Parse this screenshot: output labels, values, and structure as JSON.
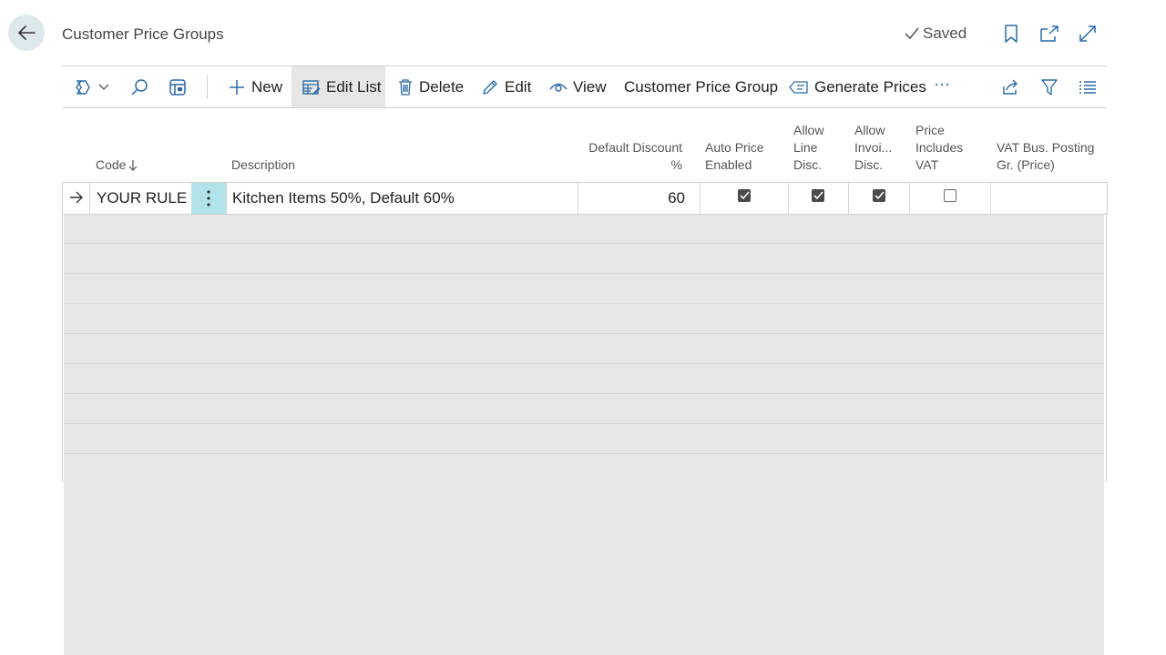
{
  "header": {
    "title": "Customer Price Groups",
    "saved_label": "Saved",
    "icons": [
      "back-arrow-icon",
      "bookmark-icon",
      "open-new-window-icon",
      "expand-icon"
    ]
  },
  "toolbar": {
    "new_label": "New",
    "edit_list_label": "Edit List",
    "delete_label": "Delete",
    "edit_label": "Edit",
    "view_label": "View",
    "customer_price_group_label": "Customer Price Group",
    "generate_prices_label": "Generate Prices",
    "more_label": "···"
  },
  "columns": {
    "code": "Code",
    "description": "Description",
    "default_discount_1": "Default Discount",
    "default_discount_2": "%",
    "auto_price_1": "Auto Price",
    "auto_price_2": "Enabled",
    "allow_line_1": "Allow",
    "allow_line_2": "Line",
    "allow_line_3": "Disc.",
    "allow_invoice_1": "Allow",
    "allow_invoice_2": "Invoi...",
    "allow_invoice_3": "Disc.",
    "price_incl_1": "Price",
    "price_incl_2": "Includes",
    "price_incl_3": "VAT",
    "vat_bus_1": "VAT Bus. Posting",
    "vat_bus_2": "Gr. (Price)"
  },
  "rows": [
    {
      "code": "YOUR RULE",
      "description": "Kitchen Items 50%, Default 60%",
      "default_discount": "60",
      "auto_price_enabled": true,
      "allow_line_disc": true,
      "allow_invoice_disc": true,
      "price_includes_vat": false,
      "vat_bus_posting_gr": ""
    }
  ],
  "colors": {
    "accent_row_menu": "#b2e3ea",
    "toolbar_active": "#e6e6e6",
    "back_button_bg": "#dde8ed"
  }
}
